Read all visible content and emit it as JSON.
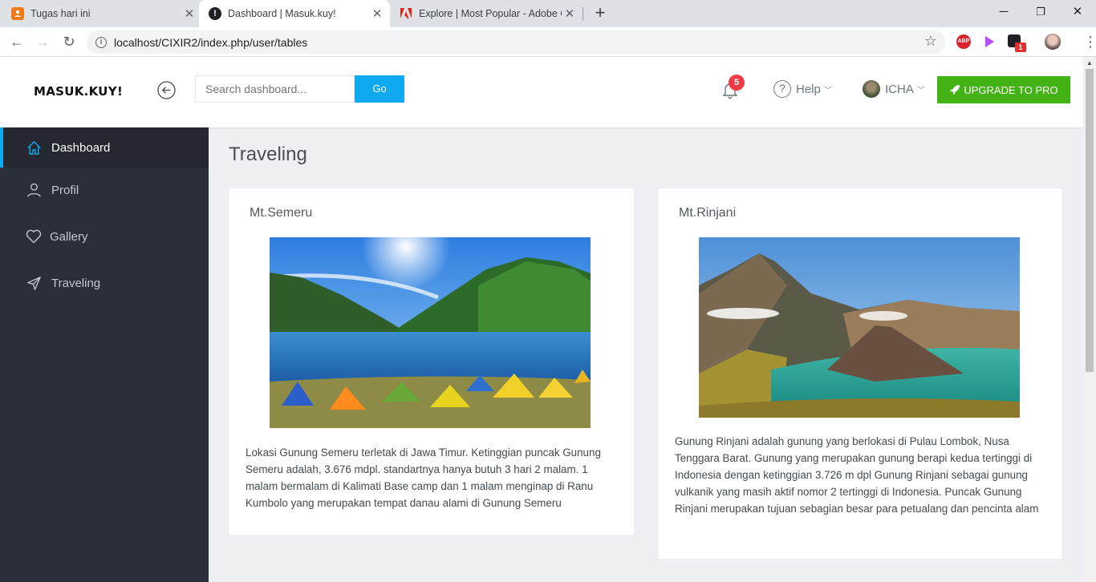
{
  "browser": {
    "tabs": [
      {
        "title": "Tugas hari ini",
        "active": false
      },
      {
        "title": "Dashboard | Masuk.kuy!",
        "active": true
      },
      {
        "title": "Explore | Most Popular - Adobe C",
        "active": false
      }
    ],
    "url": "localhost/CIXIR2/index.php/user/tables",
    "extension_badge": "1"
  },
  "header": {
    "brand": "MASUK.KUY!",
    "search_placeholder": "Search dashboard...",
    "go_label": "Go",
    "notification_count": "5",
    "help_label": "Help",
    "user_name": "ICHA",
    "upgrade_label": "UPGRADE TO PRO"
  },
  "sidebar": {
    "items": [
      {
        "label": "Dashboard",
        "icon": "home-icon",
        "active": true
      },
      {
        "label": "Profil",
        "icon": "user-icon",
        "active": false
      },
      {
        "label": "Gallery",
        "icon": "heart-icon",
        "active": false
      },
      {
        "label": "Traveling",
        "icon": "send-icon",
        "active": false
      }
    ]
  },
  "main": {
    "title": "Traveling",
    "cards": [
      {
        "title": "Mt.Semeru",
        "description": "Lokasi Gunung Semeru terletak di Jawa Timur. Ketinggian puncak Gunung Semeru adalah, 3.676 mdpl. standartnya hanya butuh 3 hari 2 malam. 1 malam bermalam di Kalimati Base camp dan 1 malam menginap di Ranu Kumbolo yang merupakan tempat danau alami di Gunung Semeru"
      },
      {
        "title": "Mt.Rinjani",
        "description": "Gunung Rinjani adalah gunung yang berlokasi di Pulau Lombok, Nusa Tenggara Barat. Gunung yang merupakan gunung berapi kedua tertinggi di Indonesia dengan ketinggian 3.726 m dpl Gunung Rinjani sebagai gunung vulkanik yang masih aktif nomor 2 tertinggi di Indonesia. Puncak Gunung Rinjani merupakan tujuan sebagian besar para petualang dan pencinta alam"
      }
    ]
  },
  "colors": {
    "accent": "#0fa9f0",
    "upgrade": "#43b215",
    "sidebar_bg": "#2b2f3a",
    "badge": "#ef3b45"
  }
}
